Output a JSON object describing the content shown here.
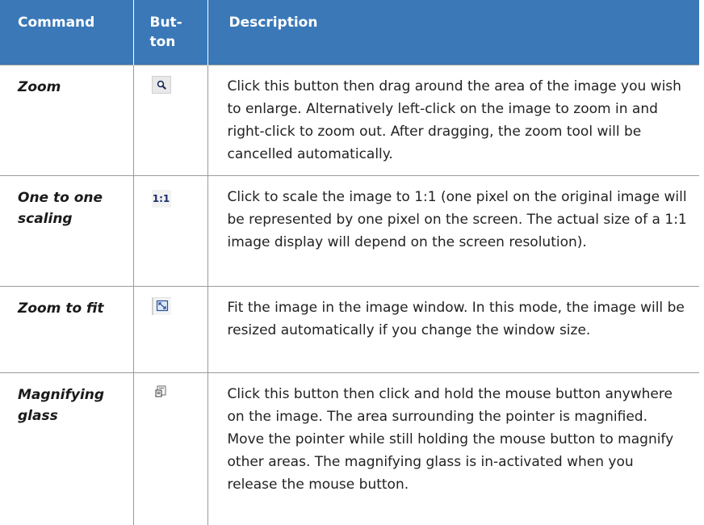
{
  "header": {
    "command": "Command",
    "button_line1": "But-",
    "button_line2": "ton",
    "description": "Description"
  },
  "rows": [
    {
      "command": "Zoom",
      "button_icon": "zoom-magnifier-icon",
      "description": "Click this button then drag around the area of the image you wish to enlarge. Alternatively left-click on the image to zoom in and right-click to zoom out. After dragging, the zoom tool will be cancelled automatically."
    },
    {
      "command": "One to one scaling",
      "button_icon": "one-to-one-icon",
      "button_text": "1:1",
      "description": "Click to scale the image to 1:1 (one pixel on the original image will be represented by one pixel on the screen. The actual size of a 1:1 image display will depend on the screen resolution)."
    },
    {
      "command": "Zoom to fit",
      "button_icon": "zoom-to-fit-icon",
      "description": "Fit the image in the image window. In this mode, the image will be resized automatically if you change the window size."
    },
    {
      "command": "Magnifying glass",
      "button_icon": "magnifying-glass-icon",
      "description": "Click this button then click and hold the mouse button anywhere on the image. The area surrounding the pointer is magnified. Move the pointer while still holding the mouse button to magnify other areas. The magnifying glass is in-activated when you release the mouse button."
    }
  ],
  "colors": {
    "header_bg": "#3a78b8",
    "header_text": "#ffffff",
    "rule": "#9a9a9a"
  }
}
